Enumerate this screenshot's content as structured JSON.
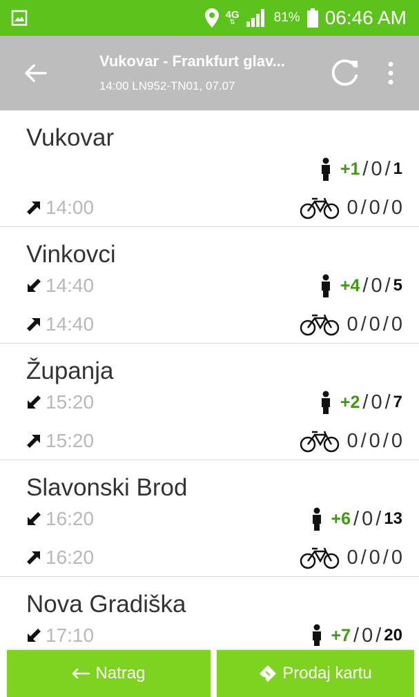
{
  "status_bar": {
    "network": "4G",
    "battery": "81%",
    "time": "06:46 AM",
    "icons": [
      "image-icon",
      "location-pin-icon",
      "signal-icon",
      "battery-icon"
    ],
    "bg_color": "#5cc31c"
  },
  "toolbar": {
    "title": "Vukovar - Frankfurt glav...",
    "subtitle": "14:00  LN952-TN01, 07.07",
    "icons": [
      "back-arrow-icon",
      "refresh-icon",
      "more-vert-icon"
    ],
    "bg_color": "#bdbdbd"
  },
  "stations": [
    {
      "name": "Vukovar",
      "arrival": "",
      "departure": "14:00",
      "passengers": {
        "plus": "+1",
        "mid": "0",
        "total": "1"
      },
      "bikes": {
        "a": "0",
        "b": "0",
        "c": "0"
      }
    },
    {
      "name": "Vinkovci",
      "arrival": "14:40",
      "departure": "14:40",
      "passengers": {
        "plus": "+4",
        "mid": "0",
        "total": "5"
      },
      "bikes": {
        "a": "0",
        "b": "0",
        "c": "0"
      }
    },
    {
      "name": "Županja",
      "arrival": "15:20",
      "departure": "15:20",
      "passengers": {
        "plus": "+2",
        "mid": "0",
        "total": "7"
      },
      "bikes": {
        "a": "0",
        "b": "0",
        "c": "0"
      }
    },
    {
      "name": "Slavonski Brod",
      "arrival": "16:20",
      "departure": "16:20",
      "passengers": {
        "plus": "+6",
        "mid": "0",
        "total": "13"
      },
      "bikes": {
        "a": "0",
        "b": "0",
        "c": "0"
      }
    },
    {
      "name": "Nova Gradiška",
      "arrival": "17:10",
      "departure": "",
      "passengers": {
        "plus": "+7",
        "mid": "0",
        "total": "20"
      },
      "bikes": {
        "a": "",
        "b": "",
        "c": ""
      }
    }
  ],
  "separator": "/",
  "buttons": {
    "back_label": "Natrag",
    "sell_label": "Prodaj kartu",
    "color": "#7ed321"
  },
  "colors": {
    "accent_green": "#3d9a12",
    "time_gray": "#b8b8b8"
  }
}
